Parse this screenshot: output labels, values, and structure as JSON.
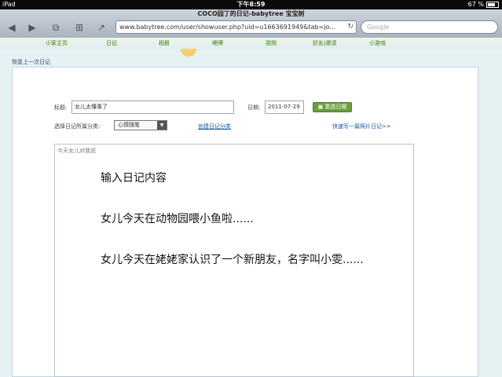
{
  "status_bar": {
    "device": "iPad",
    "time": "下午8:59",
    "battery": "67 %"
  },
  "browser": {
    "page_title": "COCO园丁的日记-babytree 宝宝树",
    "url": "www.babytree.com/user/showuser.php?uid=u1663691949&tab=jo...",
    "search_placeholder": "Google",
    "back": "◀",
    "forward": "▶",
    "tabs": "⧉",
    "bookmarks": "⊞",
    "share": "↗",
    "reload": "↻"
  },
  "site_nav": [
    "小家主页",
    "日记",
    "相册",
    "嗮博",
    "视频",
    "好友|邀请",
    "小游戏"
  ],
  "recover_link": "恢复上一次日记",
  "form": {
    "title_label": "标题:",
    "title_value": "女儿太懂事了",
    "date_label": "日期:",
    "date_value": "2011-07-29",
    "date_button": "重选日期",
    "category_label": "选择日记所属分类:",
    "category_value": "心情随笔",
    "create_category": "创建日记分类",
    "photo_diary": "快速写一篇照片日记>>"
  },
  "editor": {
    "hint": "今天女儿对我说",
    "lines": [
      "输入日记内容",
      "女儿今天在动物园喂小鱼啦......",
      "女儿今天在姥姥家认识了一个新朋友，名字叫小雯......"
    ]
  }
}
